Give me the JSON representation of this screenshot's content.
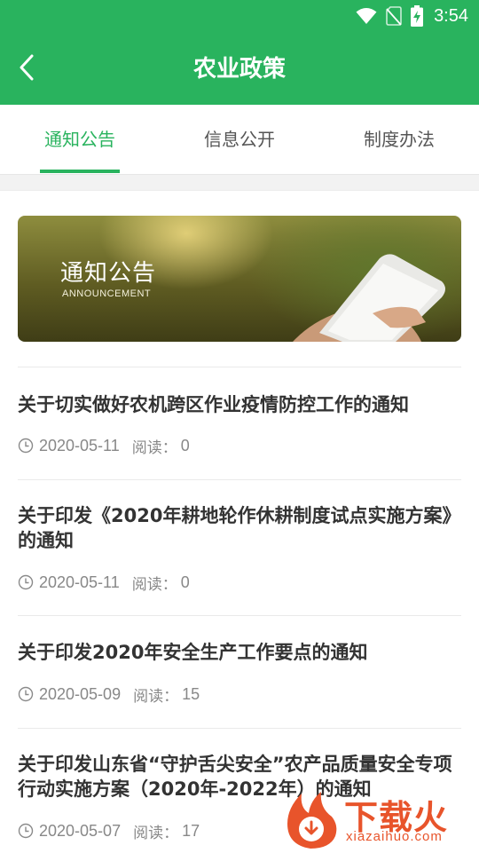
{
  "status_bar": {
    "time": "3:54",
    "icons": [
      "wifi-icon",
      "no-sim-icon",
      "battery-charging-icon"
    ]
  },
  "header": {
    "title": "农业政策",
    "back_icon": "chevron-left-icon",
    "background_color": "#29b35e"
  },
  "tabs": [
    {
      "label": "通知公告",
      "active": true
    },
    {
      "label": "信息公开",
      "active": false
    },
    {
      "label": "制度办法",
      "active": false
    }
  ],
  "banner": {
    "title": "通知公告",
    "subtitle": "ANNOUNCEMENT"
  },
  "news": [
    {
      "title": "关于切实做好农机跨区作业疫情防控工作的通知",
      "date": "2020-05-11",
      "read_label": "阅读：",
      "read_count": "0"
    },
    {
      "title": "关于印发《2020年耕地轮作休耕制度试点实施方案》的通知",
      "date": "2020-05-11",
      "read_label": "阅读：",
      "read_count": "0"
    },
    {
      "title": "关于印发2020年安全生产工作要点的通知",
      "date": "2020-05-09",
      "read_label": "阅读：",
      "read_count": "15"
    },
    {
      "title": "关于印发山东省“守护舌尖安全”农产品质量安全专项行动实施方案（2020年-2022年）的通知",
      "date": "2020-05-07",
      "read_label": "阅读：",
      "read_count": "17"
    }
  ],
  "watermark": {
    "text": "下载火",
    "url": "xiazaihuo.com"
  },
  "colors": {
    "accent": "#29b35e",
    "title_text": "#333333",
    "meta_text": "#888888",
    "watermark": "#e8542b"
  }
}
